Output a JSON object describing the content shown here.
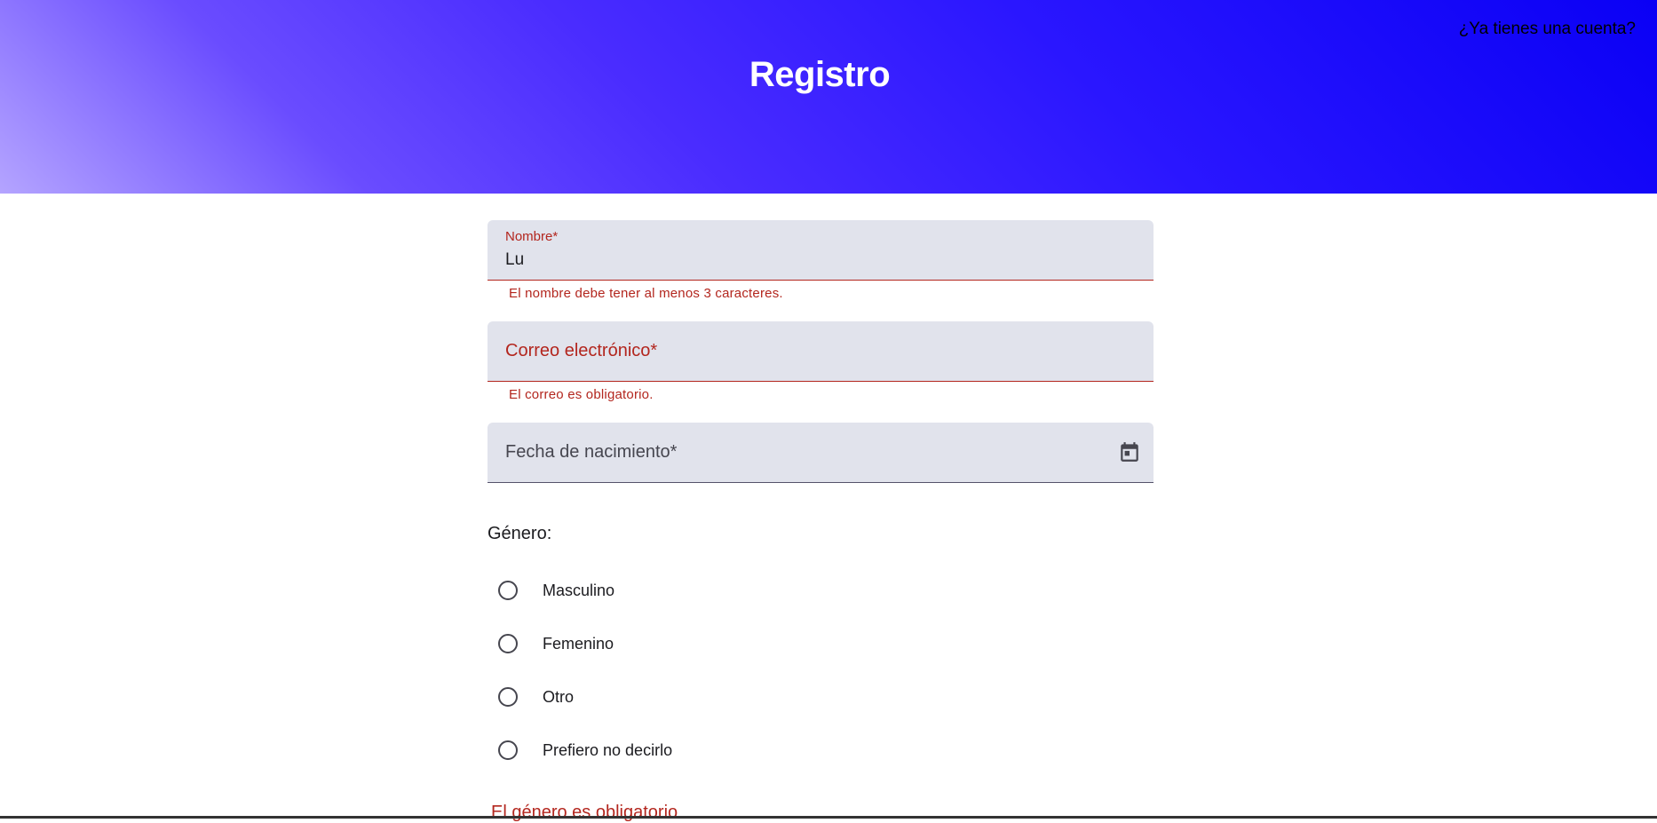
{
  "header": {
    "title": "Registro",
    "login_link": "¿Ya tienes una cuenta?"
  },
  "form": {
    "name": {
      "label": "Nombre*",
      "value": "Lu",
      "error": "El nombre debe tener al menos 3 caracteres."
    },
    "email": {
      "label": "Correo electrónico*",
      "value": "",
      "error": "El correo es obligatorio."
    },
    "birthdate": {
      "label": "Fecha de nacimiento*",
      "icon": "calendar-icon"
    },
    "gender": {
      "label": "Género:",
      "options": [
        "Masculino",
        "Femenino",
        "Otro",
        "Prefiero no decirlo"
      ],
      "error": "El género es obligatorio"
    }
  },
  "colors": {
    "error": "#b3261e",
    "field_bg": "#e1e3ec",
    "header_start": "#b4a4ff",
    "header_end": "#0a00f5"
  }
}
